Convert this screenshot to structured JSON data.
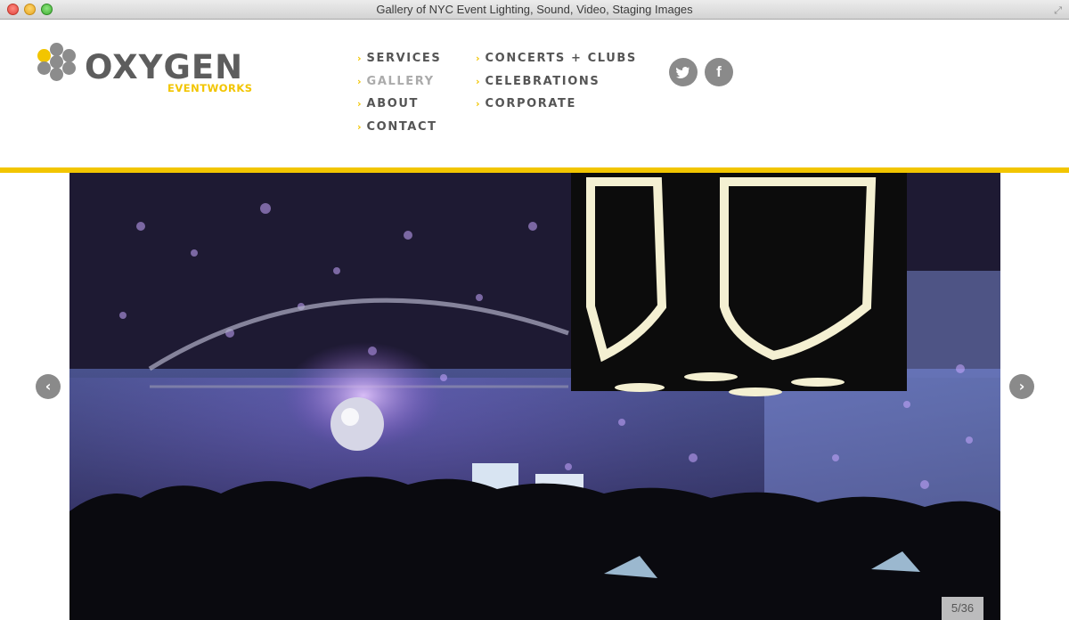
{
  "window": {
    "title": "Gallery of NYC Event Lighting, Sound, Video, Staging Images"
  },
  "brand": {
    "name": "OXYGEN",
    "tagline": "EVENTWORKS",
    "accent_color": "#f2c500",
    "gray_color": "#5d5d5d"
  },
  "nav": {
    "col1": [
      {
        "label": "SERVICES",
        "active": false
      },
      {
        "label": "GALLERY",
        "active": true
      },
      {
        "label": "ABOUT",
        "active": false
      },
      {
        "label": "CONTACT",
        "active": false
      }
    ],
    "col2": [
      {
        "label": "CONCERTS + CLUBS",
        "active": false
      },
      {
        "label": "CELEBRATIONS",
        "active": false
      },
      {
        "label": "CORPORATE",
        "active": false
      }
    ],
    "chevron": "›"
  },
  "social": {
    "twitter_icon": "twitter-bird-icon",
    "facebook_icon": "facebook-f-icon",
    "facebook_glyph": "f"
  },
  "gallery": {
    "counter": "5/36",
    "current": 5,
    "total": 36,
    "prev_glyph": "‹",
    "next_glyph": "›",
    "photo_description_icon": "event-photo"
  }
}
